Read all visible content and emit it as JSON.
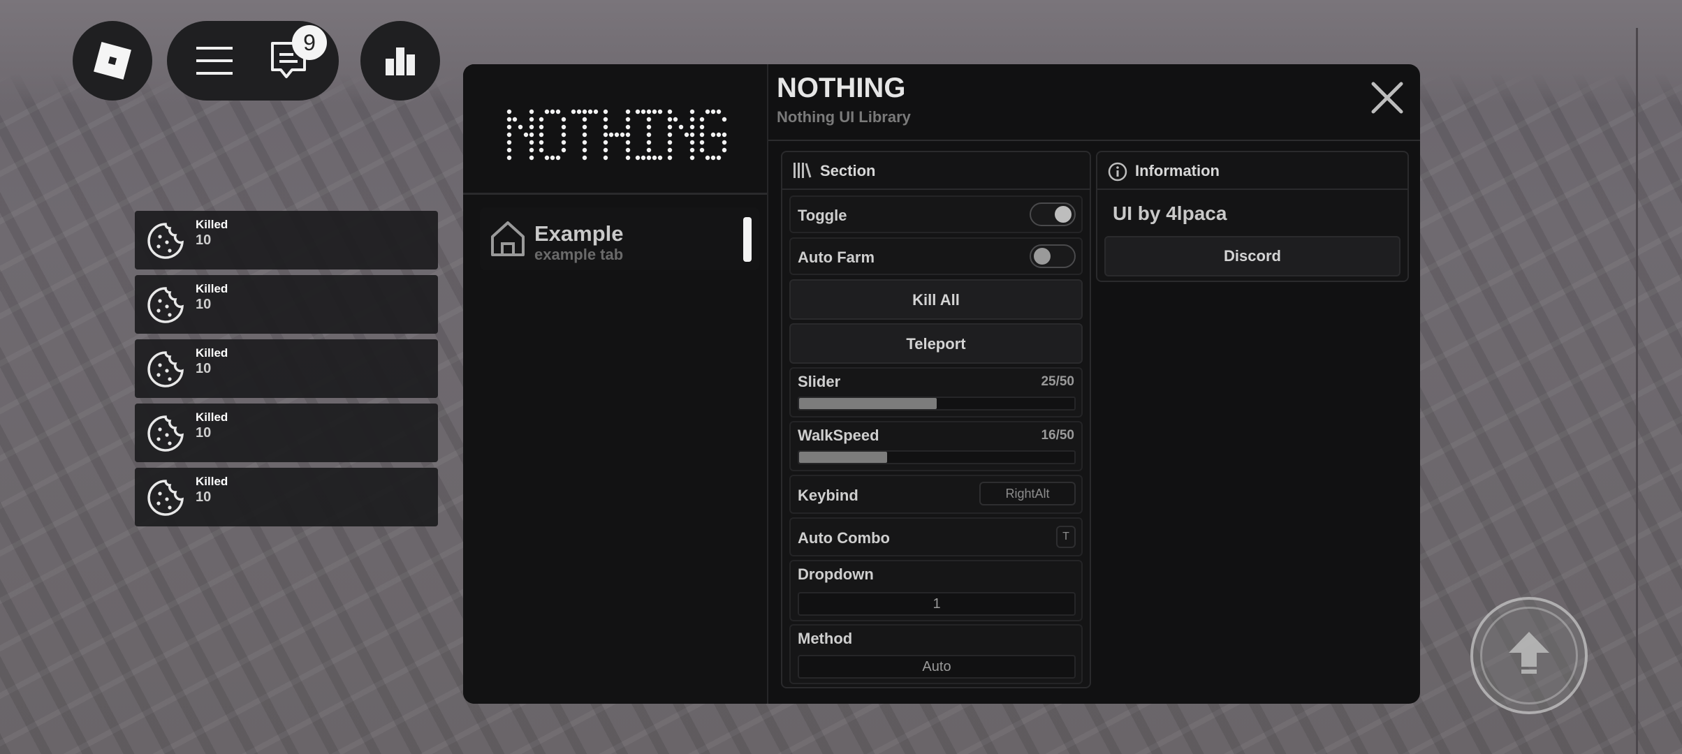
{
  "topbar": {
    "roblox_icon": "roblox-logo-icon",
    "menu_icon": "hamburger-menu-icon",
    "chat_icon": "chat-icon",
    "chat_badge": "9",
    "leaderboard_icon": "leaderboard-icon"
  },
  "killfeed": [
    {
      "title": "Killed",
      "value": "10"
    },
    {
      "title": "Killed",
      "value": "10"
    },
    {
      "title": "Killed",
      "value": "10"
    },
    {
      "title": "Killed",
      "value": "10"
    },
    {
      "title": "Killed",
      "value": "10"
    }
  ],
  "window": {
    "logo_text": "NOTHING",
    "title": "NOTHING",
    "subtitle": "Nothing UI Library",
    "close_icon": "close-icon"
  },
  "sidebar": {
    "tabs": [
      {
        "label": "Example",
        "sublabel": "example tab",
        "icon": "home-icon"
      }
    ]
  },
  "section": {
    "title": "Section",
    "icon": "library-icon",
    "toggle": {
      "label": "Toggle",
      "state": true
    },
    "auto_farm": {
      "label": "Auto Farm",
      "state": false
    },
    "kill_all": {
      "label": "Kill All"
    },
    "teleport": {
      "label": "Teleport"
    },
    "slider": {
      "label": "Slider",
      "value_text": "25/50",
      "value": 25,
      "max": 50
    },
    "walkspeed": {
      "label": "WalkSpeed",
      "value_text": "16/50",
      "value": 16,
      "max": 50
    },
    "keybind": {
      "label": "Keybind",
      "key": "RightAlt"
    },
    "auto_combo": {
      "label": "Auto Combo",
      "key": "T"
    },
    "dropdown": {
      "label": "Dropdown",
      "selected": "1"
    },
    "method": {
      "label": "Method",
      "selected": "Auto"
    }
  },
  "info": {
    "title": "Information",
    "icon": "info-icon",
    "text": "UI by 4lpaca",
    "discord": {
      "label": "Discord"
    }
  },
  "jump_button": {
    "icon": "jump-arrow-icon"
  },
  "colors": {
    "panel": "#111112",
    "accent": "#f2f2f2"
  }
}
